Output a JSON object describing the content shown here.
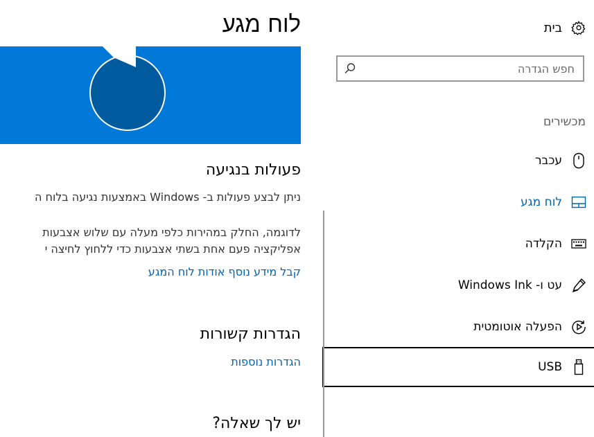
{
  "nav": {
    "home_label": "בית",
    "search": {
      "placeholder": "חפש הגדרה"
    },
    "section_label": "מכשירים",
    "items": [
      {
        "label": "עכבר",
        "icon": "mouse-icon"
      },
      {
        "label": "לוח מגע",
        "icon": "touchpad-icon"
      },
      {
        "label": "הקלדה",
        "icon": "keyboard-icon"
      },
      {
        "label": "עט ו- Windows Ink",
        "icon": "pen-icon"
      },
      {
        "label": "הפעלה אוטומטית",
        "icon": "autoplay-icon"
      },
      {
        "label": "USB",
        "icon": "usb-icon"
      }
    ],
    "active_item": "לוח מגע",
    "focused_item": "USB"
  },
  "main": {
    "title": "לוח מגע",
    "gestures": {
      "heading": "פעולות בנגיעה",
      "line1": "ניתן לבצע פעולות ב- Windows באמצעות נגיעה בלוח ה",
      "line2": "לדוגמה, החלק במהירות כלפי מעלה עם שלוש אצבעות",
      "line3": "אפליקציה פעם אחת בשתי אצבעות כדי ללחוץ לחיצה י",
      "link": "קבל מידע נוסף אודות לוח המגע"
    },
    "related": {
      "heading": "הגדרות קשורות",
      "link": "הגדרות נוספות"
    },
    "question": {
      "heading": "יש לך שאלה?"
    }
  },
  "colors": {
    "accent": "#0078d7",
    "accent_dark": "#005a9e",
    "link": "#0063b1"
  }
}
